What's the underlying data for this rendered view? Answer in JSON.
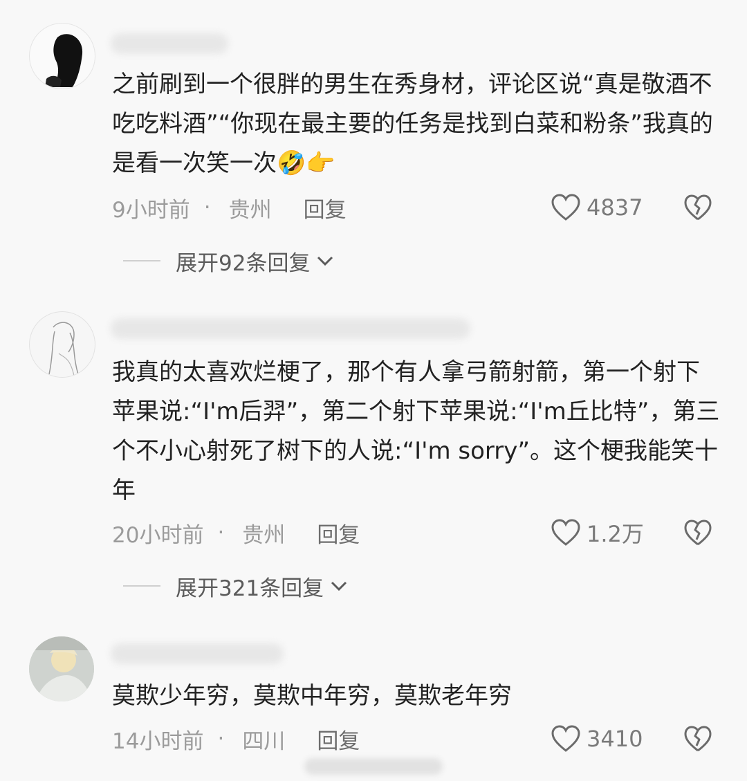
{
  "comments": [
    {
      "text": "之前刷到一个很胖的男生在秀身材，评论区说“真是敬酒不吃吃料酒”“你现在最主要的任务是找到白菜和粉条”我真的是看一次笑一次",
      "emoji": "🤣👉",
      "time": "9小时前",
      "location": "贵州",
      "reply_label": "回复",
      "likes": "4837",
      "expand_label": "展开92条回复"
    },
    {
      "text": "我真的太喜欢烂梗了，那个有人拿弓箭射箭，第一个射下苹果说:“I'm后羿”，第二个射下苹果说:“I'm丘比特”，第三个不小心射死了树下的人说:“I'm sorry”。这个梗我能笑十年",
      "time": "20小时前",
      "location": "贵州",
      "reply_label": "回复",
      "likes": "1.2万",
      "expand_label": "展开321条回复"
    },
    {
      "text": "莫欺少年穷，莫欺中年穷，莫欺老年穷",
      "time": "14小时前",
      "location": "四川",
      "reply_label": "回复",
      "likes": "3410"
    }
  ],
  "separator": "·",
  "icons": {
    "like": "heart-outline-icon",
    "dislike": "broken-heart-icon",
    "expand": "chevron-down-icon"
  },
  "colors": {
    "background": "#f8f8f8",
    "text": "#222222",
    "meta": "#9b9b9b"
  }
}
